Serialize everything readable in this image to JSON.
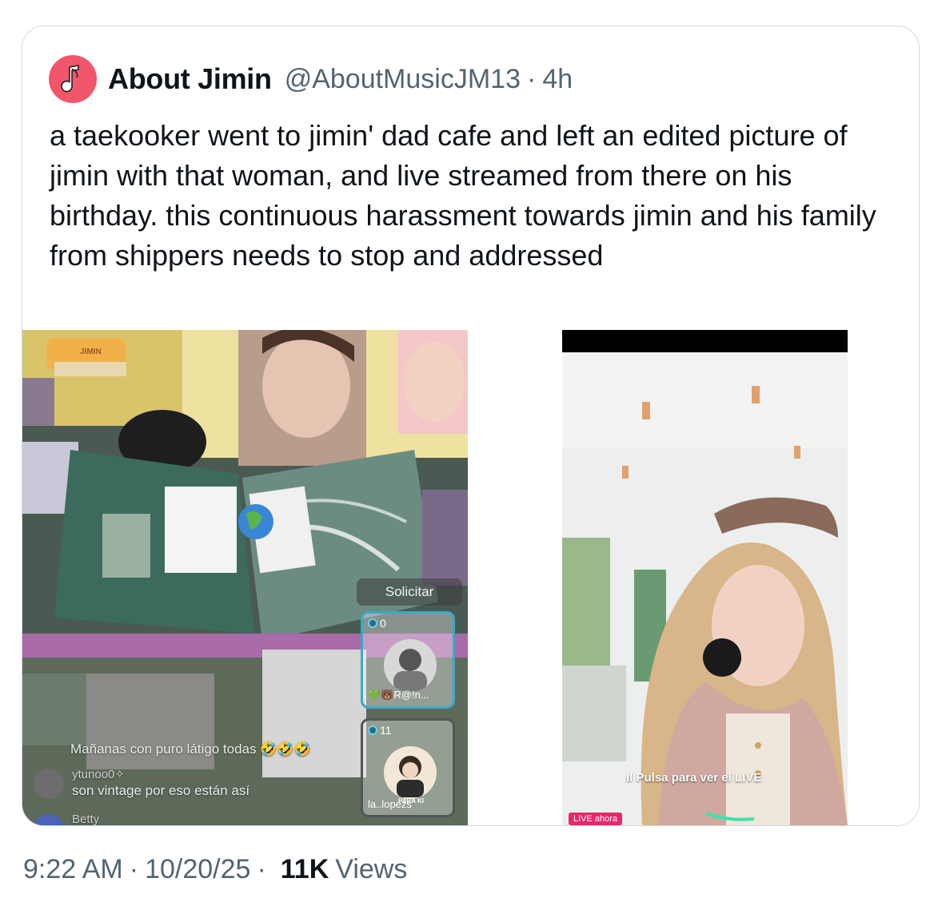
{
  "tweet": {
    "author_name": "About Jimin",
    "author_handle": "@AboutMusicJM13",
    "separator": "·",
    "relative_time": "4h",
    "text": "a taekooker went to jimin' dad cafe and left an edited picture of jimin with that woman, and live streamed from there on his birthday. this continuous harassment towards jimin and his family from shippers needs to stop and addressed",
    "avatar_icon": "music-note-icon",
    "avatar_color": "#f2566a"
  },
  "media": {
    "left_stream": {
      "cake_label": "JIMIN",
      "request_button": "Solicitar",
      "guests": [
        {
          "count": "0",
          "name": "💚🐻R@!n..."
        },
        {
          "count": "11",
          "name": "la..lopezs",
          "badge": "PARA KI"
        }
      ],
      "comments": [
        {
          "text": "Mañanas con puro látigo todas 🤣🤣🤣"
        },
        {
          "user": "ytunoo0✧",
          "text": "son vintage por eso están así"
        },
        {
          "user": "Betty"
        }
      ]
    },
    "right_stream": {
      "live_hint": "ıl Pulsa para ver el LIVE",
      "live_badge": "LIVE ahora"
    }
  },
  "footer": {
    "time": "9:22 AM",
    "date": "10/20/25",
    "views_count": "11K",
    "views_label": "Views",
    "separator": "·"
  }
}
